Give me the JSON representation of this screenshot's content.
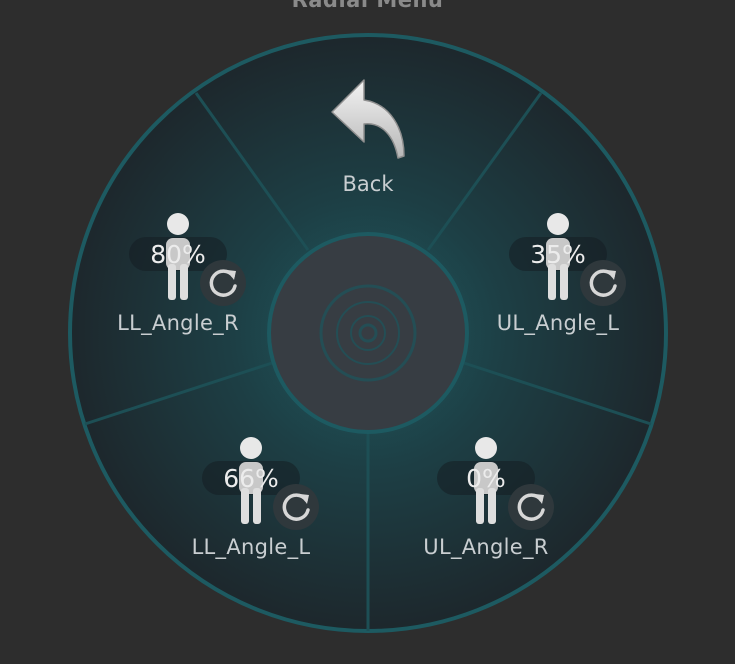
{
  "menu": {
    "title": "Radial Menu",
    "back_label": "Back",
    "items": [
      {
        "label": "LL_Angle_R",
        "percent_text": "80%",
        "percent": 80
      },
      {
        "label": "UL_Angle_L",
        "percent_text": "35%",
        "percent": 35
      },
      {
        "label": "LL_Angle_L",
        "percent_text": "66%",
        "percent": 66
      },
      {
        "label": "UL_Angle_R",
        "percent_text": "0%",
        "percent": 0
      }
    ]
  },
  "icons": {
    "back": "back-arrow-icon",
    "person": "person-icon",
    "reset": "reset-icon",
    "center": "center-target-icon"
  },
  "colors": {
    "background": "#2d2d2d",
    "wheel_fill": "#1e2b30",
    "wheel_glow": "#1f5a60",
    "rim": "#1d5a61",
    "divider": "#1d4f55",
    "hub": "#373d43",
    "text": "#c9ced1"
  }
}
